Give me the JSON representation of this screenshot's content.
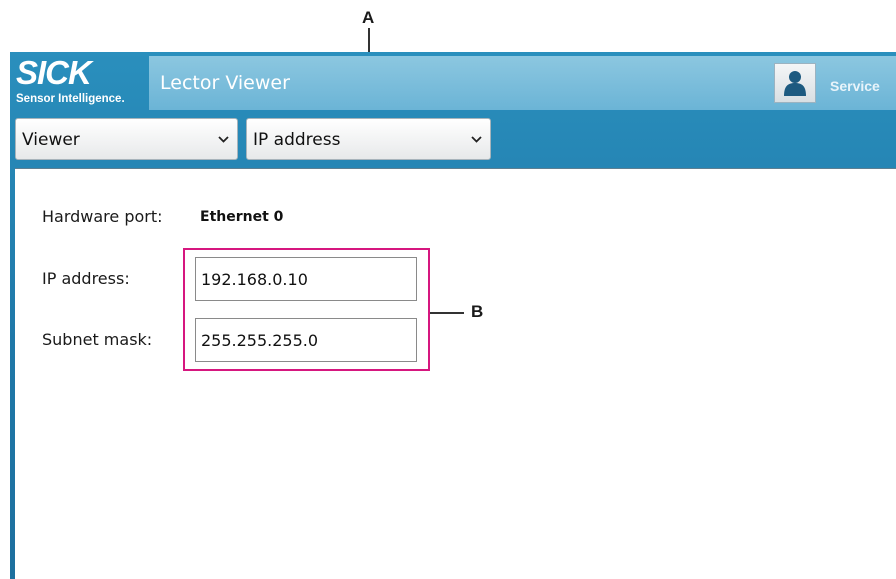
{
  "callouts": {
    "a": "A",
    "b": "B",
    "highlight_color": "#d6177f"
  },
  "header": {
    "logo_text": "SICK",
    "logo_tagline": "Sensor Intelligence.",
    "app_title": "Lector Viewer",
    "user_icon": "user-icon",
    "service_label": "Service"
  },
  "toolbar": {
    "mode_select": "Viewer",
    "page_select": "IP address"
  },
  "form": {
    "hardware_port_label": "Hardware port:",
    "hardware_port_value": "Ethernet 0",
    "ip_label": "IP address:",
    "ip_value": "192.168.0.10",
    "subnet_label": "Subnet mask:",
    "subnet_value": "255.255.255.0"
  },
  "colors": {
    "brand_blue": "#1f78a8",
    "title_band": "#7dbedb"
  }
}
